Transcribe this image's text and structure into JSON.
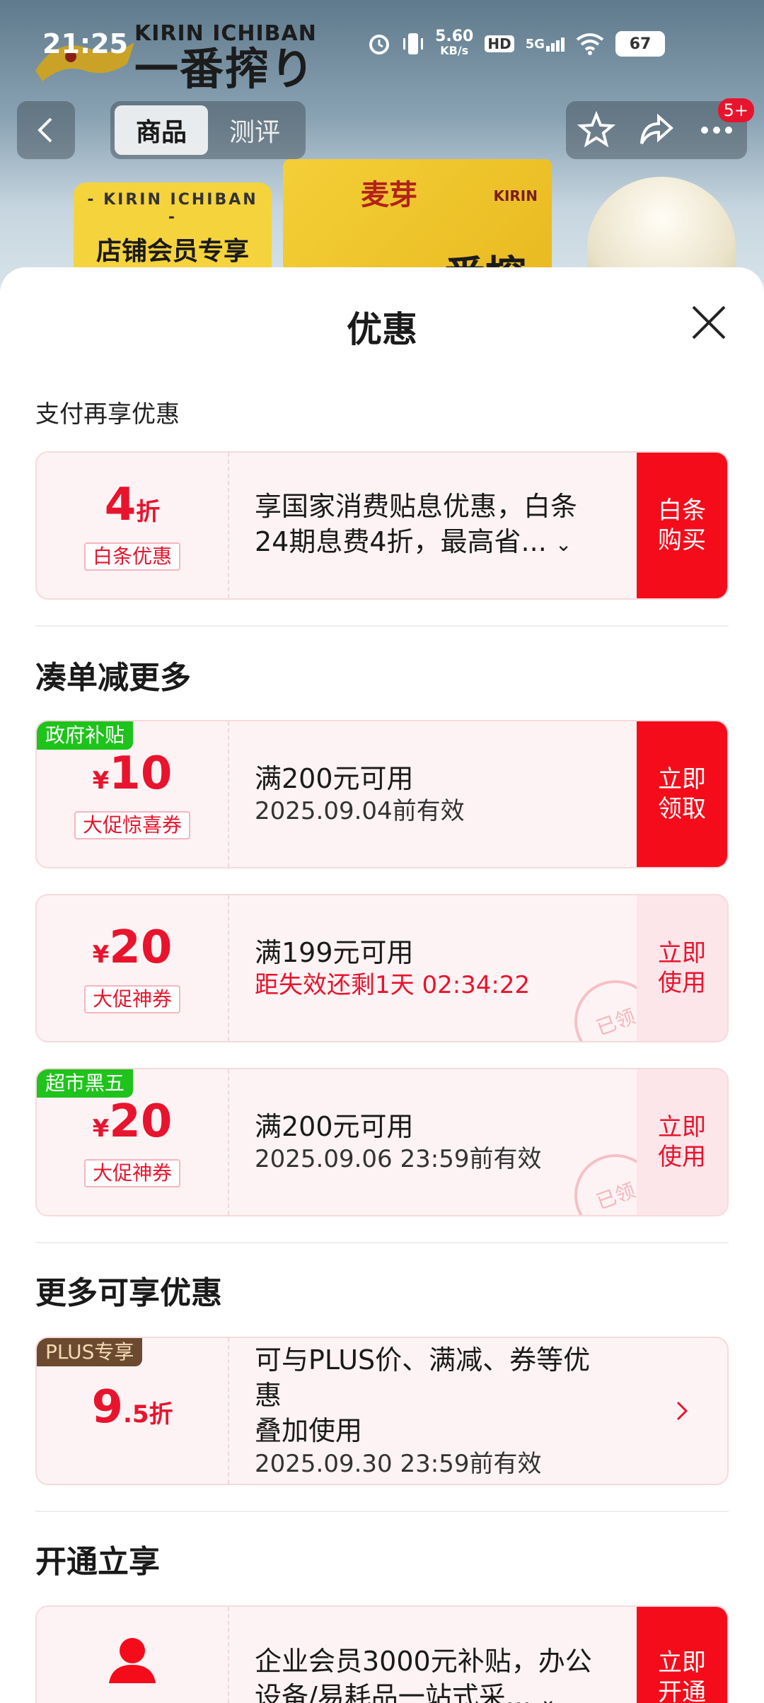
{
  "status_bar": {
    "time": "21:25",
    "net_speed": "5.60\nKB/s",
    "net_top": "5.60",
    "net_bot": "KB/s",
    "hd": "HD",
    "signal": "5G",
    "battery": "67"
  },
  "header": {
    "brand_en": "KIRIN ICHIBAN",
    "brand_zh": "一番搾り",
    "member_small": "- KIRIN ICHIBAN -",
    "member_big": "店铺会员专享",
    "box_maiya": "麦芽",
    "box_kirin": "KIRIN",
    "box_yiban": "一番搾り",
    "tabs": [
      {
        "label": "商品",
        "active": true
      },
      {
        "label": "测评",
        "active": false
      }
    ],
    "badge": "5+"
  },
  "sheet": {
    "title": "优惠",
    "section_pay": "支付再享优惠",
    "pay_coupon": {
      "amount": "4",
      "unit": "折",
      "tag": "白条优惠",
      "desc": "享国家消费贴息优惠，白条24期息费4折，最高省...",
      "action": "白条\n购买",
      "action_l1": "白条",
      "action_l2": "购买"
    },
    "section_combine": "凑单减更多",
    "coupons": [
      {
        "corner": "政府补贴",
        "yen": "¥",
        "amount": "10",
        "tag": "大促惊喜券",
        "condition": "满200元可用",
        "sub": "2025.09.04前有效",
        "sub_red": false,
        "action_l1": "立即",
        "action_l2": "领取",
        "style": "solid",
        "stamp": ""
      },
      {
        "corner": "",
        "yen": "¥",
        "amount": "20",
        "tag": "大促神券",
        "condition": "满199元可用",
        "sub": "距失效还剩1天 02:34:22",
        "sub_red": true,
        "action_l1": "立即",
        "action_l2": "使用",
        "style": "soft",
        "stamp": "已领"
      },
      {
        "corner": "超市黑五",
        "yen": "¥",
        "amount": "20",
        "tag": "大促神券",
        "condition": "满200元可用",
        "sub": "2025.09.06 23:59前有效",
        "sub_red": false,
        "action_l1": "立即",
        "action_l2": "使用",
        "style": "soft",
        "stamp": "已领"
      }
    ],
    "section_more": "更多可享优惠",
    "plus_coupon": {
      "corner": "PLUS专享",
      "amount": "9",
      "decimal": ".5折",
      "desc_l1": "可与PLUS价、满减、券等优惠",
      "desc_l2": "叠加使用",
      "sub": "2025.09.30 23:59前有效"
    },
    "section_open": "开通立享",
    "open_coupon": {
      "desc": "企业会员3000元补贴，办公设备/易耗品一站式采...",
      "action_l1": "立即",
      "action_l2": "开通"
    }
  },
  "colors": {
    "accent": "#f50c1a",
    "accent_text": "#e8142d",
    "green_tag": "#1ec31b",
    "plus_tag": "#6b4a2f"
  }
}
